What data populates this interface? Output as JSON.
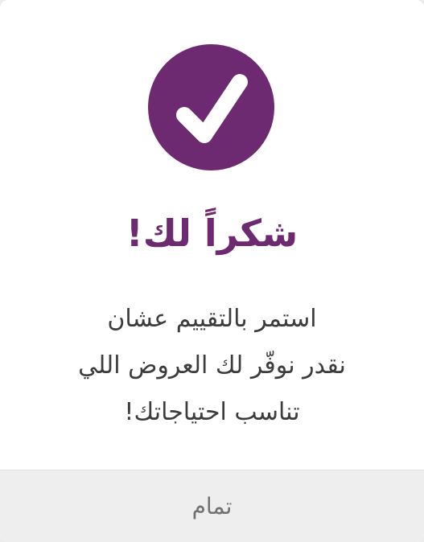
{
  "dialog": {
    "icon": "checkmark-icon",
    "accent_color": "#6d2a70",
    "title": "شكراً لك!",
    "message_lines": [
      "استمر بالتقييم عشان",
      "نقدر نوفّر لك العروض اللي",
      "تناسب احتياجاتك!"
    ],
    "ok_label": "تمام"
  }
}
